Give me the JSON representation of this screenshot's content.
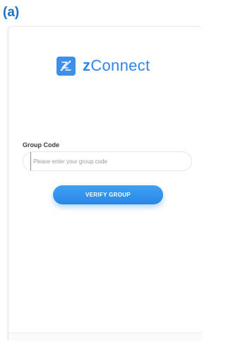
{
  "figure_label": "(a)",
  "brand": {
    "prefix": "z",
    "name": "Connect",
    "icon": "zconnect-logo-icon",
    "color": "#2f87e6"
  },
  "form": {
    "field_label": "Group Code",
    "input_placeholder": "Please enter your group code",
    "input_value": "",
    "button_label": "VERIFY GROUP",
    "button_color": "#2a86e4"
  },
  "colors": {
    "label_accent": "#1a73c9",
    "background": "#ffffff"
  }
}
